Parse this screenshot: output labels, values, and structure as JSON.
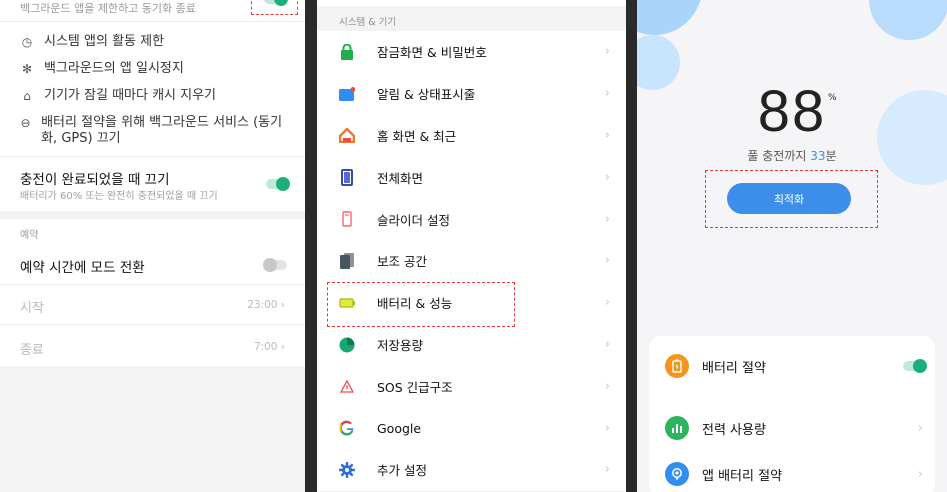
{
  "panel1": {
    "top_subtitle": "백그라운드 앱을 제한하고 동기화 종료",
    "options": [
      {
        "icon": "clock-icon",
        "glyph": "◷",
        "text": "시스템 앱의 활동 제한"
      },
      {
        "icon": "snowflake-icon",
        "glyph": "✻",
        "text": "백그라운드의 앱 일시정지"
      },
      {
        "icon": "broom-icon",
        "glyph": "⌂",
        "text": "기기가 잠길 때마다 캐시 지우기"
      },
      {
        "icon": "minus-circle-icon",
        "glyph": "⊖",
        "text": "배터리 절약을 위해 백그라운드 서비스 (동기화, GPS) 끄기"
      }
    ],
    "charge_off": {
      "title": "충전이 완료되었을 때 끄기",
      "subtitle": "배터리가 60% 또는 완전히 충전되었을 때 끄기",
      "enabled": true
    },
    "schedule_section": "예약",
    "schedule_toggle": {
      "title": "예약 시간에 모드 전환",
      "enabled": false
    },
    "start": {
      "label": "시작",
      "value": "23:00"
    },
    "end": {
      "label": "종료",
      "value": "7:00"
    }
  },
  "panel2": {
    "section_caption": "시스템 & 기기",
    "items": [
      {
        "label": "잠금화면 & 비밀번호",
        "icon": "lock-icon",
        "color": "#1fae4a"
      },
      {
        "label": "알림 & 상태표시줄",
        "icon": "notification-icon",
        "color": "#2f8ef0"
      },
      {
        "label": "홈 화면 & 최근",
        "icon": "home-icon",
        "color": "#f0772a"
      },
      {
        "label": "전체화면",
        "icon": "fullscreen-icon",
        "color": "#3a4aa8"
      },
      {
        "label": "슬라이더 설정",
        "icon": "slider-icon",
        "color": "#f06b6b"
      },
      {
        "label": "보조 공간",
        "icon": "clone-icon",
        "color": "#4a5560"
      },
      {
        "label": "배터리 & 성능",
        "icon": "battery-icon",
        "color": "#b8c81e"
      },
      {
        "label": "저장용량",
        "icon": "storage-icon",
        "color": "#18a872"
      },
      {
        "label": "SOS 긴급구조",
        "icon": "sos-icon",
        "color": "#ef4a4a"
      },
      {
        "label": "Google",
        "icon": "google-icon",
        "color": "#4285f4"
      },
      {
        "label": "추가 설정",
        "icon": "gear-icon",
        "color": "#2f6fd6"
      }
    ],
    "chevron": "›"
  },
  "panel3": {
    "battery_percent": "88",
    "percent_sign": "%",
    "charge_prefix": "풀 충전까지 ",
    "charge_minutes": "33",
    "charge_suffix": "분",
    "optimize_button": "최적화",
    "card_rows": [
      {
        "label": "배터리 절약",
        "icon": "battery-saver-icon",
        "color": "#f5951c",
        "glyph": "▮",
        "control": "toggle-on"
      },
      {
        "label": "전력 사용량",
        "icon": "bar-chart-icon",
        "color": "#2db45d",
        "glyph": "▮",
        "control": "chevron"
      },
      {
        "label": "앱 배터리 절약",
        "icon": "app-battery-icon",
        "color": "#2f8ef0",
        "glyph": "●",
        "control": "chevron"
      }
    ],
    "chevron": "›"
  }
}
